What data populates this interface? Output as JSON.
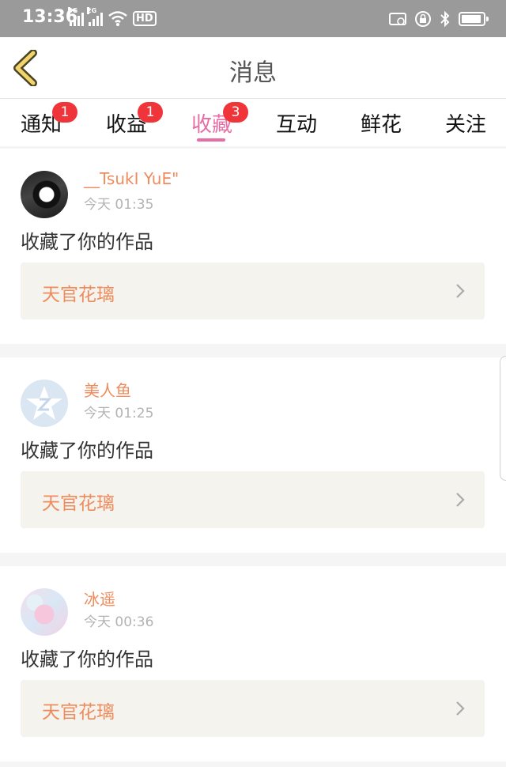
{
  "status_bar": {
    "time": "13:36",
    "net1": "4G",
    "net2": "2G",
    "hd_label": "HD",
    "icons": [
      "signal-4g-icon",
      "signal-2g-icon",
      "wifi-icon",
      "hd-icon",
      "cast-icon",
      "lock-rotation-icon",
      "bluetooth-icon",
      "battery-icon"
    ]
  },
  "header": {
    "title": "消息",
    "back_icon": "chevron-left-icon"
  },
  "tabs": [
    {
      "label": "通知",
      "badge": "1"
    },
    {
      "label": "收益",
      "badge": "1"
    },
    {
      "label": "收藏",
      "badge": "3",
      "active": true
    },
    {
      "label": "互动"
    },
    {
      "label": "鲜花"
    },
    {
      "label": "关注"
    }
  ],
  "messages": [
    {
      "user": "__TsukI YuE\"",
      "time": "今天 01:35",
      "action": "收藏了你的作品",
      "work": "天官花璃"
    },
    {
      "user": "美人鱼",
      "time": "今天 01:25",
      "action": "收藏了你的作品",
      "work": "天官花璃"
    },
    {
      "user": "冰遥",
      "time": "今天 00:36",
      "action": "收藏了你的作品",
      "work": "天官花璃"
    }
  ],
  "colors": {
    "accent_pink": "#e66ea5",
    "badge_red": "#f0353a",
    "name_orange": "#ee8c5e",
    "back_yellow": "#f2d46a"
  }
}
